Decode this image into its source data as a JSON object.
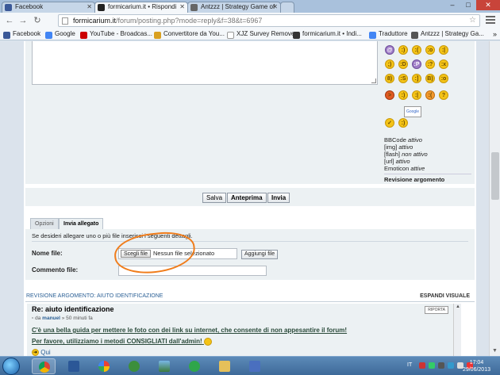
{
  "browser": {
    "tabs": [
      {
        "label": "Facebook",
        "icon": "facebook-icon",
        "active": false
      },
      {
        "label": "formicarium.it • Rispondi",
        "icon": "ant-icon",
        "active": true
      },
      {
        "label": "Antzzz | Strategy Game of",
        "icon": "antzzz-icon",
        "active": false
      }
    ],
    "window_controls": {
      "minimize": "–",
      "maximize": "□",
      "close": "✕"
    },
    "url_host": "formicarium.it",
    "url_path": "/forum/posting.php?mode=reply&f=38&t=6967",
    "bookmarks": [
      {
        "label": "Facebook",
        "icon": "facebook-icon",
        "color": "#3b5998"
      },
      {
        "label": "Google",
        "icon": "google-icon",
        "color": "#4285f4"
      },
      {
        "label": "YouTube - Broadcas...",
        "icon": "youtube-icon",
        "color": "#cc0000"
      },
      {
        "label": "Convertitore da You...",
        "icon": "converter-icon",
        "color": "#d9a020"
      },
      {
        "label": "XJZ Survey Remover",
        "icon": "page-icon",
        "color": "#cccccc"
      },
      {
        "label": "formicarium.it • Indi...",
        "icon": "ant-icon",
        "color": "#333333"
      },
      {
        "label": "Traduttore",
        "icon": "translate-icon",
        "color": "#4285f4"
      },
      {
        "label": "Antzzz | Strategy Ga...",
        "icon": "antzzz-icon",
        "color": "#555555"
      }
    ],
    "bookmarks_more": "»"
  },
  "editor": {
    "bbcode_label": "BBCode",
    "bbcode_status": "attivo",
    "img_label": "[img]",
    "img_status": "attivo",
    "flash_label": "[flash]",
    "flash_status": "non attivo",
    "url_label": "[url]",
    "url_status": "attivo",
    "emoticon_label": "Emoticon",
    "emoticon_status": "attive",
    "review_label": "Revisione argomento",
    "google_sign": "Google"
  },
  "buttons": {
    "save": "Salva",
    "preview": "Anteprima",
    "submit": "Invia"
  },
  "option_tabs": [
    {
      "label": "Opzioni",
      "active": false
    },
    {
      "label": "Invia allegato",
      "active": true
    }
  ],
  "attachment": {
    "description": "Se desideri allegare uno o più file inserisci i seguenti dettagli.",
    "file_label": "Nome file:",
    "choose_button": "Scegli file",
    "no_file": "Nessun file selezionato",
    "add_button": "Aggiungi file",
    "comment_label": "Commento file:"
  },
  "review": {
    "heading": "REVISIONE ARGOMENTO: AIUTO IDENTIFICAZIONE",
    "expand": "ESPANDI VISUALE",
    "post_title": "Re: aiuto identificazione",
    "meta_prefix": "da",
    "meta_author": "manuel",
    "meta_time": "» 50 minuti fa",
    "quote_button": "RIPORTA",
    "line1": "C'è una bella guida per mettere le foto con dei link su internet, che consente di non appesantire il forum!",
    "line2": "Per favore, utilizziamo i metodi CONSIGLIATI dall'admin!",
    "link": "Qui"
  },
  "taskbar": {
    "language": "IT",
    "time": "17:04",
    "date": "29/06/2013"
  },
  "colors": {
    "annotation_circle": "#f07c1a",
    "link_blue": "#2a5f95",
    "panel_bg": "#ecf1f3"
  }
}
